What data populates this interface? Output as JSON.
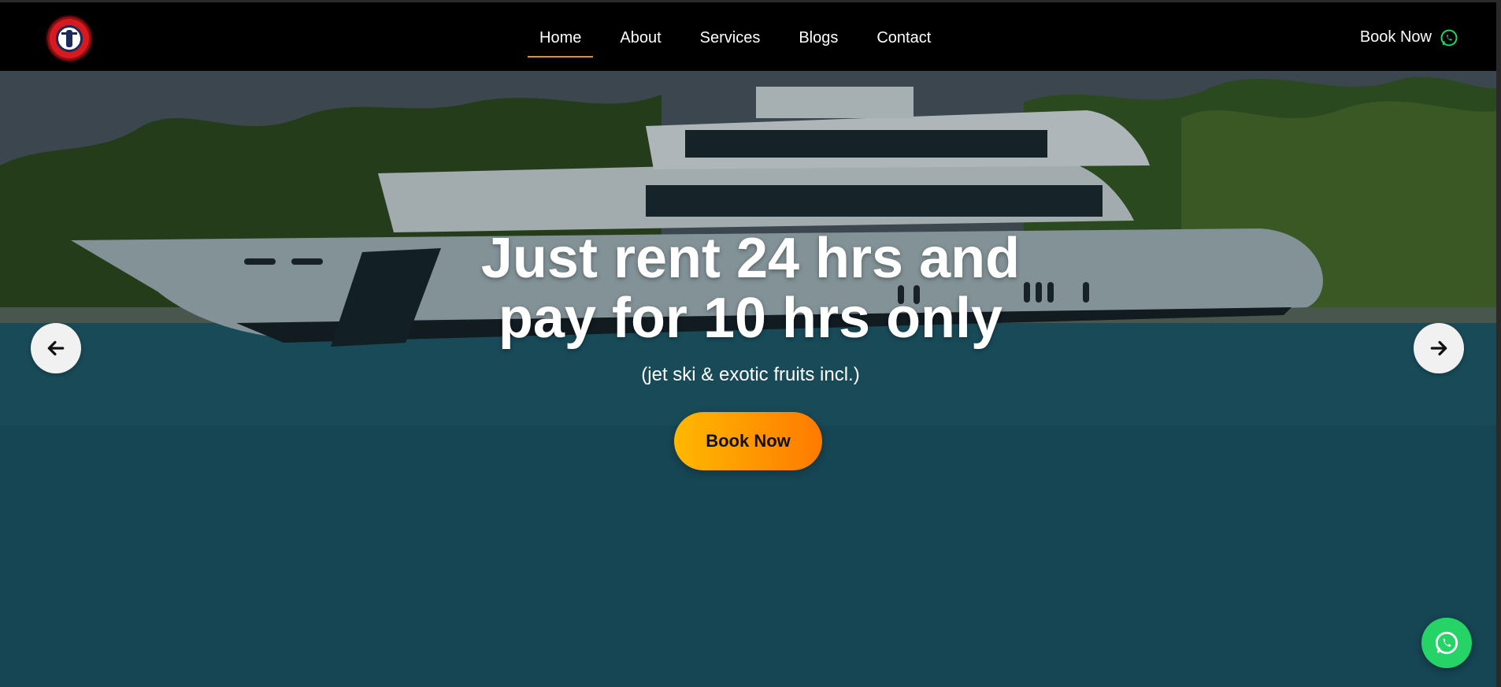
{
  "header": {
    "nav": [
      {
        "label": "Home",
        "active": true
      },
      {
        "label": "About",
        "active": false
      },
      {
        "label": "Services",
        "active": false
      },
      {
        "label": "Blogs",
        "active": false
      },
      {
        "label": "Contact",
        "active": false
      }
    ],
    "book_label": "Book Now",
    "book_icon": "whatsapp-icon",
    "accent_color": "#f28a1c"
  },
  "hero": {
    "title_line1": "Just rent 24 hrs and",
    "title_line2": "pay for 10 hrs only",
    "subtitle": "(jet ski & exotic fruits incl.)",
    "cta_label": "Book Now",
    "cta_gradient": [
      "#ffb800",
      "#ff7a00"
    ],
    "prev_icon": "arrow-left-icon",
    "next_icon": "arrow-right-icon"
  },
  "floating": {
    "whatsapp_icon": "whatsapp-icon",
    "whatsapp_color": "#25d366"
  }
}
